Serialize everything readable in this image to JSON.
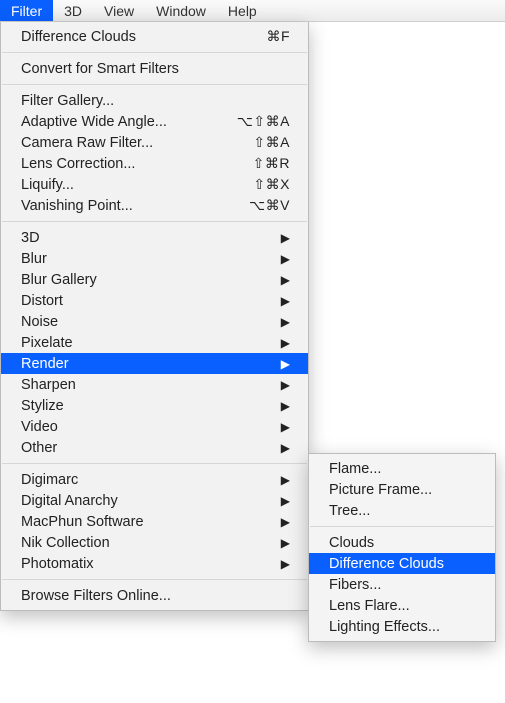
{
  "menubar": [
    {
      "label": "Filter",
      "selected": true
    },
    {
      "label": "3D"
    },
    {
      "label": "View"
    },
    {
      "label": "Window"
    },
    {
      "label": "Help"
    }
  ],
  "dropdown": {
    "groups": [
      [
        {
          "label": "Difference Clouds",
          "shortcut": "⌘F"
        }
      ],
      [
        {
          "label": "Convert for Smart Filters"
        }
      ],
      [
        {
          "label": "Filter Gallery..."
        },
        {
          "label": "Adaptive Wide Angle...",
          "shortcut": "⌥⇧⌘A"
        },
        {
          "label": "Camera Raw Filter...",
          "shortcut": "⇧⌘A"
        },
        {
          "label": "Lens Correction...",
          "shortcut": "⇧⌘R"
        },
        {
          "label": "Liquify...",
          "shortcut": "⇧⌘X"
        },
        {
          "label": "Vanishing Point...",
          "shortcut": "⌥⌘V"
        }
      ],
      [
        {
          "label": "3D",
          "submenu": true
        },
        {
          "label": "Blur",
          "submenu": true
        },
        {
          "label": "Blur Gallery",
          "submenu": true
        },
        {
          "label": "Distort",
          "submenu": true
        },
        {
          "label": "Noise",
          "submenu": true
        },
        {
          "label": "Pixelate",
          "submenu": true
        },
        {
          "label": "Render",
          "submenu": true,
          "selected": true
        },
        {
          "label": "Sharpen",
          "submenu": true
        },
        {
          "label": "Stylize",
          "submenu": true
        },
        {
          "label": "Video",
          "submenu": true
        },
        {
          "label": "Other",
          "submenu": true
        }
      ],
      [
        {
          "label": "Digimarc",
          "submenu": true
        },
        {
          "label": "Digital Anarchy",
          "submenu": true
        },
        {
          "label": "MacPhun Software",
          "submenu": true
        },
        {
          "label": "Nik Collection",
          "submenu": true
        },
        {
          "label": "Photomatix",
          "submenu": true
        }
      ],
      [
        {
          "label": "Browse Filters Online..."
        }
      ]
    ]
  },
  "submenu": {
    "groups": [
      [
        {
          "label": "Flame..."
        },
        {
          "label": "Picture Frame..."
        },
        {
          "label": "Tree..."
        }
      ],
      [
        {
          "label": "Clouds"
        },
        {
          "label": "Difference Clouds",
          "selected": true
        },
        {
          "label": "Fibers..."
        },
        {
          "label": "Lens Flare..."
        },
        {
          "label": "Lighting Effects..."
        }
      ]
    ]
  }
}
